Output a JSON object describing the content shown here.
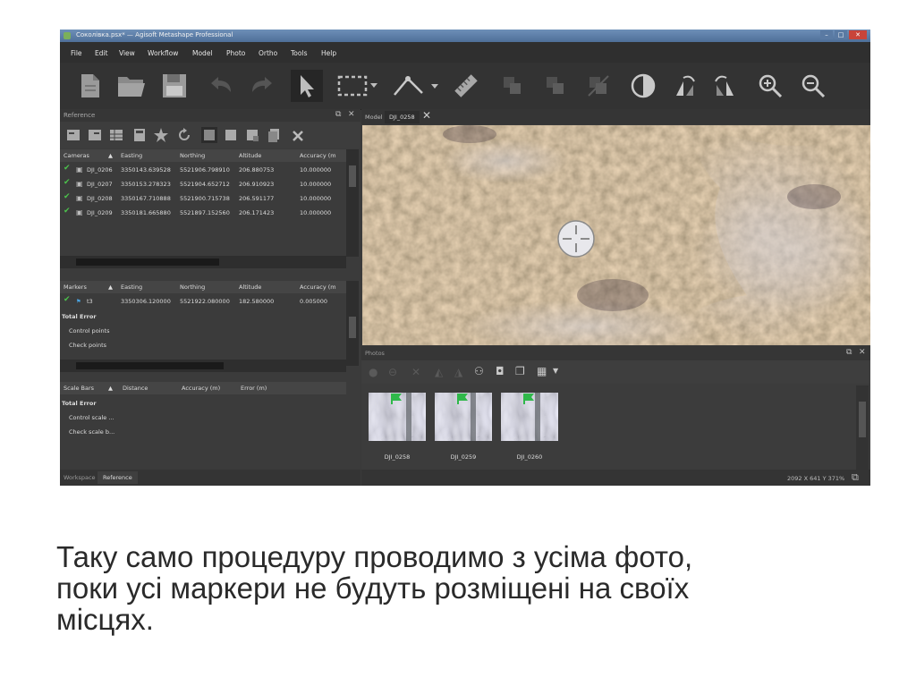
{
  "window": {
    "title": "Соколівка.psx* — Agisoft Metashape Professional"
  },
  "menu": [
    "File",
    "Edit",
    "View",
    "Workflow",
    "Model",
    "Photo",
    "Ortho",
    "Tools",
    "Help"
  ],
  "toolbar": {
    "icons": [
      "new-document-icon",
      "open-folder-icon",
      "save-icon",
      "undo-icon",
      "redo-icon",
      "pointer-icon",
      "rectangle-selection-icon",
      "ruler-icon",
      "measure-icon",
      "reset-view-icon",
      "enable-cameras-icon",
      "disable-cameras-icon",
      "contrast-icon",
      "rotate-left-icon",
      "rotate-right-icon",
      "zoom-in-icon",
      "zoom-out-icon"
    ]
  },
  "reference": {
    "title": "Reference",
    "cameras": {
      "headers": [
        "Cameras",
        "Easting",
        "Northing",
        "Altitude",
        "Accuracy (m"
      ],
      "rows": [
        {
          "label": "DJI_0206",
          "easting": "3350143.639528",
          "northing": "5521906.798910",
          "altitude": "206.880753",
          "accuracy": "10.000000"
        },
        {
          "label": "DJI_0207",
          "easting": "3350153.278323",
          "northing": "5521904.652712",
          "altitude": "206.910923",
          "accuracy": "10.000000"
        },
        {
          "label": "DJI_0208",
          "easting": "3350167.710888",
          "northing": "5521900.715738",
          "altitude": "206.591177",
          "accuracy": "10.000000"
        },
        {
          "label": "DJI_0209",
          "easting": "3350181.665880",
          "northing": "5521897.152560",
          "altitude": "206.171423",
          "accuracy": "10.000000"
        }
      ]
    },
    "markers": {
      "headers": [
        "Markers",
        "Easting",
        "Northing",
        "Altitude",
        "Accuracy (m"
      ],
      "rows": [
        {
          "label": "t3",
          "easting": "3350306.120000",
          "northing": "5521922.080000",
          "altitude": "182.580000",
          "accuracy": "0.005000"
        }
      ],
      "total_error": "Total Error",
      "control_points": "Control points",
      "check_points": "Check points"
    },
    "scale_bars": {
      "headers": [
        "Scale Bars",
        "Distance",
        "Accuracy (m)",
        "Error (m)"
      ],
      "total_error": "Total Error",
      "control": "Control scale ...",
      "check": "Check scale b..."
    },
    "bottom_tabs": [
      "Workspace",
      "Reference"
    ]
  },
  "view": {
    "tabs": [
      "Model",
      "DJI_0258"
    ]
  },
  "photos": {
    "title": "Photos",
    "items": [
      "DJI_0258",
      "DJI_0259",
      "DJI_0260"
    ]
  },
  "status": "2092 X 641 Y 371%",
  "caption": {
    "line1": "Таку само процедуру проводимо з усіма фото,",
    "line2": "поки усі маркери не будуть розміщені на своїх",
    "line3": "місцях."
  },
  "colors": {
    "check": "#4cc24c",
    "marker_flag": "#2fb84a",
    "accent_titlebar": "#5f81ab"
  }
}
